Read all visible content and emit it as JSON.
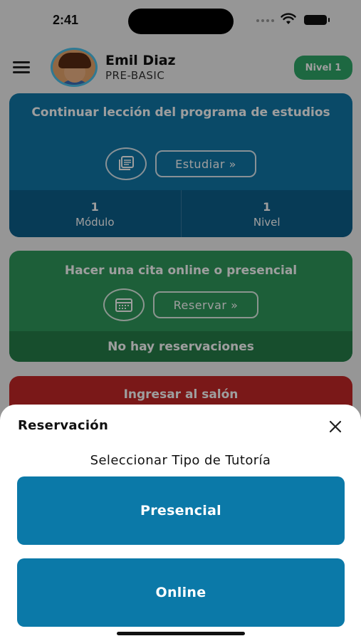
{
  "status_bar": {
    "time": "2:41"
  },
  "header": {
    "user_name": "Emil Diaz",
    "user_level": "PRE-BASIC",
    "badge": "Nivel 1"
  },
  "study_card": {
    "title": "Continuar lección del programa de estudios",
    "button": "Estudiar »",
    "stats": [
      {
        "value": "1",
        "label": "Módulo"
      },
      {
        "value": "1",
        "label": "Nivel"
      }
    ],
    "color": "#1178a8"
  },
  "booking_card": {
    "title": "Hacer una cita online o presencial",
    "button": "Reservar »",
    "footer": "No hay reservaciones",
    "color": "#2f9a5c"
  },
  "classroom_card": {
    "title": "Ingresar al salón",
    "color": "#c62828"
  },
  "sheet": {
    "title": "Reservación",
    "subtitle": "Seleccionar Tipo de Tutoría",
    "options": [
      "Presencial",
      "Online"
    ],
    "accent": "#0b79a8"
  },
  "icons": {
    "menu": "hamburger-menu-icon",
    "study": "book-stack-icon",
    "calendar": "calendar-icon",
    "close": "close-icon"
  }
}
